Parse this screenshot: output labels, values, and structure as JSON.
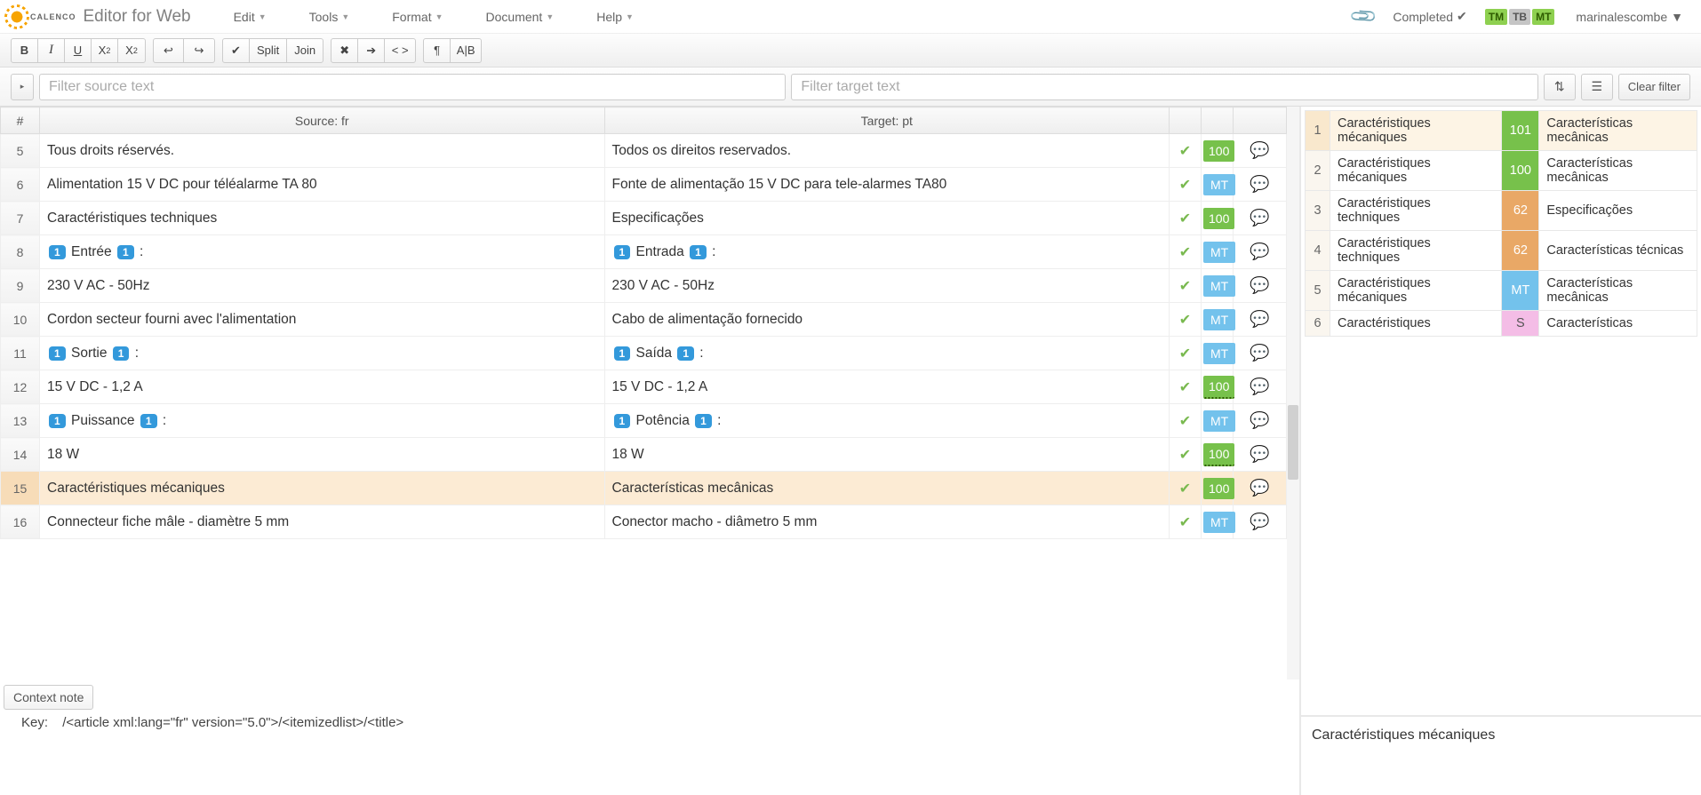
{
  "app": {
    "brand": "CALENCO",
    "title": "Editor for Web"
  },
  "menus": {
    "edit": "Edit",
    "tools": "Tools",
    "format": "Format",
    "document": "Document",
    "help": "Help"
  },
  "status": {
    "label": "Completed"
  },
  "badges": {
    "tm": "TM",
    "tb": "TB",
    "mt": "MT"
  },
  "user": {
    "name": "marinalescombe"
  },
  "toolbar": {
    "split": "Split",
    "join": "Join"
  },
  "filters": {
    "source_placeholder": "Filter source text",
    "target_placeholder": "Filter target text",
    "clear": "Clear filter"
  },
  "grid": {
    "headers": {
      "num": "#",
      "source": "Source: fr",
      "target": "Target: pt"
    },
    "rows": [
      {
        "n": "5",
        "src": "Tous droits réservés.",
        "tgt": "Todos os direitos reservados.",
        "score": "100",
        "stype": "s100"
      },
      {
        "n": "6",
        "src": "Alimentation 15 V DC pour téléalarme TA 80",
        "tgt": "Fonte de alimentação 15 V DC para tele-alarmes TA80",
        "score": "MT",
        "stype": "smt"
      },
      {
        "n": "7",
        "src": "Caractéristiques techniques",
        "tgt": "Especificações",
        "score": "100",
        "stype": "s100"
      },
      {
        "n": "8",
        "src_pre": "1",
        "src": "Entrée",
        "src_post": "1",
        "src_tail": " :",
        "tgt_pre": "1",
        "tgt": "Entrada",
        "tgt_post": "1",
        "tgt_tail": " :",
        "score": "MT",
        "stype": "smt",
        "tags": true
      },
      {
        "n": "9",
        "src": "230 V AC - 50Hz",
        "tgt": "230 V AC - 50Hz",
        "score": "MT",
        "stype": "smt"
      },
      {
        "n": "10",
        "src": "Cordon secteur fourni avec l'alimentation",
        "tgt": "Cabo de alimentação fornecido",
        "score": "MT",
        "stype": "smt"
      },
      {
        "n": "11",
        "src_pre": "1",
        "src": "Sortie",
        "src_post": "1",
        "src_tail": " :",
        "tgt_pre": "1",
        "tgt": "Saída",
        "tgt_post": "1",
        "tgt_tail": " :",
        "score": "MT",
        "stype": "smt",
        "tags": true
      },
      {
        "n": "12",
        "src": "15 V DC - 1,2 A",
        "tgt": "15 V DC - 1,2 A",
        "score": "100",
        "stype": "s100u"
      },
      {
        "n": "13",
        "src_pre": "1",
        "src": "Puissance",
        "src_post": "1",
        "src_tail": "  :",
        "tgt_pre": "1",
        "tgt": "Potência",
        "tgt_post": "1",
        "tgt_tail": " :",
        "score": "MT",
        "stype": "smt",
        "tags": true
      },
      {
        "n": "14",
        "src": "18 W",
        "tgt": "18 W",
        "score": "100",
        "stype": "s100u"
      },
      {
        "n": "15",
        "src": "Caractéristiques mécaniques",
        "tgt": "Características mecânicas",
        "score": "100",
        "stype": "s100",
        "selected": true
      },
      {
        "n": "16",
        "src": "Connecteur fiche mâle - diamètre  5 mm",
        "tgt": "Conector macho - diâmetro 5 mm",
        "score": "MT",
        "stype": "smt"
      }
    ]
  },
  "context": {
    "button": "Context note",
    "key_label": "Key:",
    "key_value": "/<article xml:lang=\"fr\" version=\"5.0\">/<itemizedlist>/<title>"
  },
  "tm": {
    "rows": [
      {
        "n": "1",
        "src": "Caractéristiques mécaniques",
        "score": "101",
        "sc": "g",
        "tgt": "Características mecânicas",
        "sel": true
      },
      {
        "n": "2",
        "src": "Caractéristiques mécaniques",
        "score": "100",
        "sc": "g",
        "tgt": "Características mecânicas"
      },
      {
        "n": "3",
        "src": "Caractéristiques techniques",
        "score": "62",
        "sc": "o",
        "tgt": "Especificações"
      },
      {
        "n": "4",
        "src": "Caractéristiques techniques",
        "score": "62",
        "sc": "o",
        "tgt": "Características técnicas"
      },
      {
        "n": "5",
        "src": "Caractéristiques mécaniques",
        "score": "MT",
        "sc": "b",
        "tgt": "Características mecânicas"
      },
      {
        "n": "6",
        "src": "Caractéristiques",
        "score": "S",
        "sc": "p",
        "tgt": "Características"
      }
    ],
    "detail": "Caractéristiques mécaniques"
  }
}
